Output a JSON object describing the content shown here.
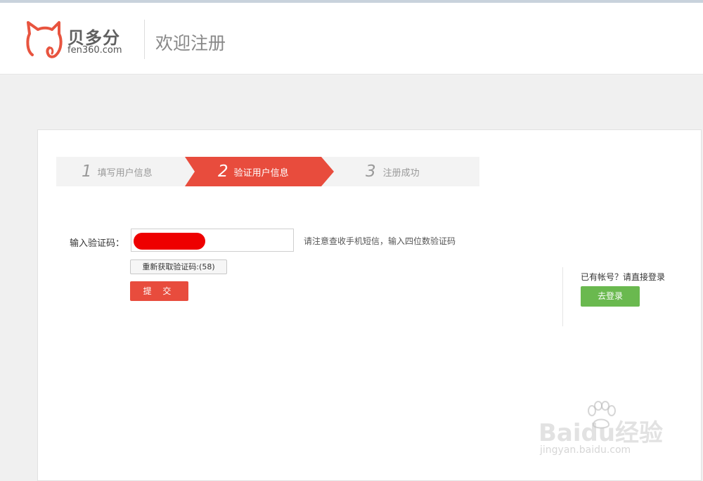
{
  "header": {
    "brand_name": "贝多分",
    "brand_domain": "fen360.com",
    "title": "欢迎注册",
    "logo_icon": "cat-outline-icon",
    "logo_color": "#e8543f"
  },
  "steps": [
    {
      "number": "1",
      "label": "填写用户信息",
      "state": "done"
    },
    {
      "number": "2",
      "label": "验证用户信息",
      "state": "active"
    },
    {
      "number": "3",
      "label": "注册成功",
      "state": "pending"
    }
  ],
  "form": {
    "code_label": "输入验证码：",
    "code_value": "",
    "hint": "请注意查收手机短信，输入四位数验证码",
    "resend_label": "重新获取验证码:(58)",
    "submit_label": "提 交"
  },
  "side": {
    "prompt": "已有帐号？请直接登录",
    "login_label": "去登录"
  },
  "watermark": {
    "main": "Baidu经验",
    "sub": "jingyan.baidu.com"
  },
  "colors": {
    "accent_red": "#e84c3d",
    "login_green": "#6ab94f",
    "page_bg": "#f0f0f0"
  }
}
